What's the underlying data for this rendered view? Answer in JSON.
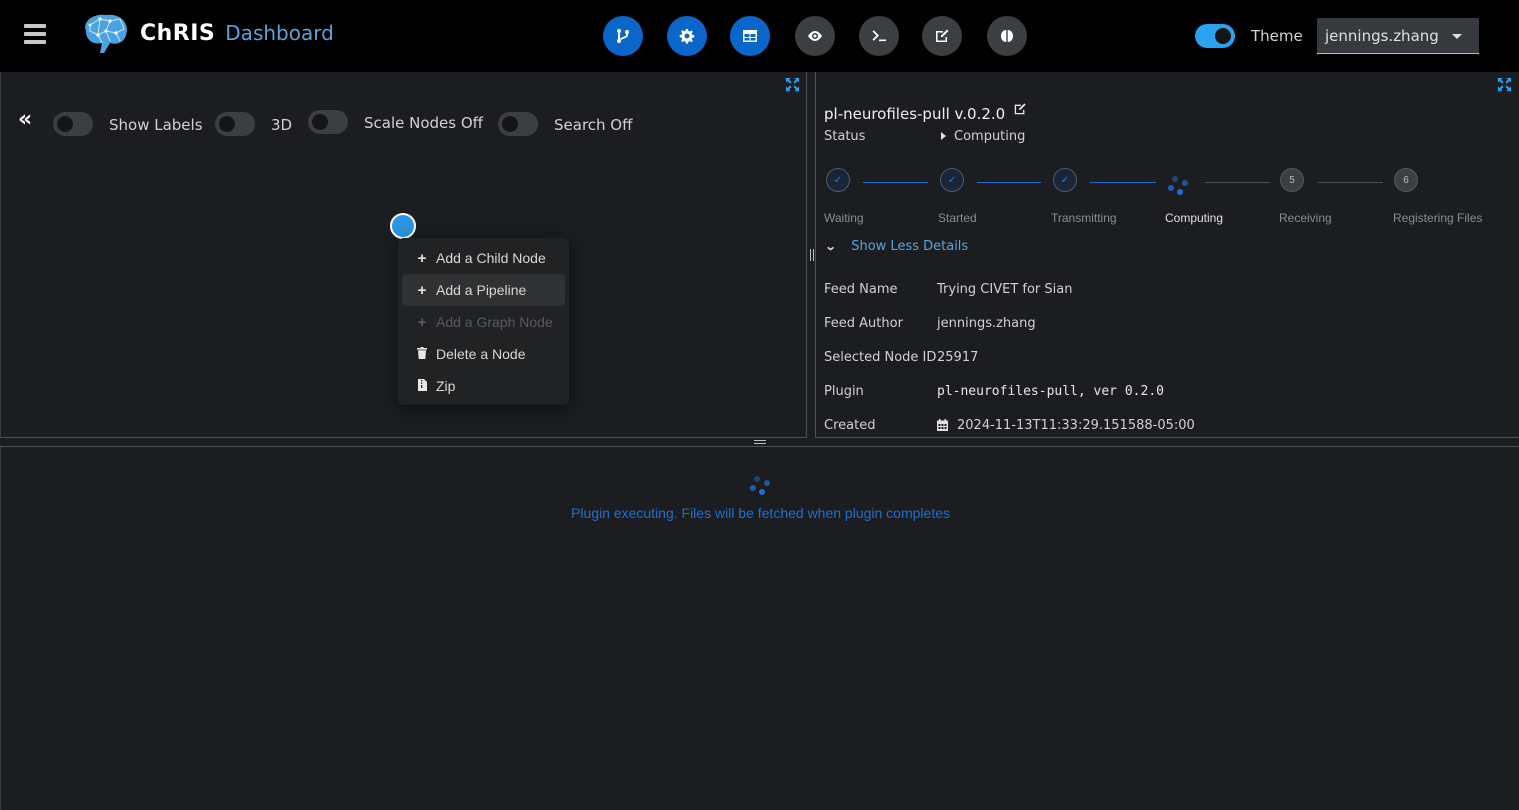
{
  "header": {
    "brand_name": "ChRIS",
    "brand_sub": "Dashboard",
    "menu_icon": "hamburger-icon",
    "tools": [
      {
        "name": "graph-tool-button",
        "icon": "code-branch-icon",
        "active": true
      },
      {
        "name": "node-settings-button",
        "icon": "gear-icon",
        "active": true
      },
      {
        "name": "table-view-button",
        "icon": "table-icon",
        "active": true
      },
      {
        "name": "preview-button",
        "icon": "eye-icon",
        "active": false
      },
      {
        "name": "terminal-button",
        "icon": "terminal-icon",
        "active": false
      },
      {
        "name": "notes-button",
        "icon": "edit-icon",
        "active": false
      },
      {
        "name": "brain-viewer-button",
        "icon": "brain-icon",
        "active": false
      }
    ],
    "theme_label": "Theme",
    "theme_on": true,
    "user": "jennings.zhang"
  },
  "graph": {
    "toggles": [
      {
        "label": "Show Labels",
        "on": false
      },
      {
        "label": "3D",
        "on": false
      },
      {
        "label": "Scale Nodes Off",
        "on": false
      },
      {
        "label": "Search Off",
        "on": false
      }
    ],
    "context_menu": [
      {
        "icon": "plus-icon",
        "label": "Add a Child Node",
        "disabled": false,
        "highlighted": false
      },
      {
        "icon": "plus-icon",
        "label": "Add a Pipeline",
        "disabled": false,
        "highlighted": true
      },
      {
        "icon": "plus-icon",
        "label": "Add a Graph Node",
        "disabled": true,
        "highlighted": false
      },
      {
        "icon": "trash-icon",
        "label": "Delete a Node",
        "disabled": false,
        "highlighted": false
      },
      {
        "icon": "file-zip-icon",
        "label": "Zip",
        "disabled": false,
        "highlighted": false
      }
    ]
  },
  "details": {
    "title": "pl-neurofiles-pull v.0.2.0",
    "status_label": "Status",
    "status_value": "Computing",
    "steps": [
      {
        "label": "Waiting",
        "state": "done"
      },
      {
        "label": "Started",
        "state": "done"
      },
      {
        "label": "Transmitting",
        "state": "done"
      },
      {
        "label": "Computing",
        "state": "current"
      },
      {
        "label": "Receiving",
        "state": "pending",
        "number": "5"
      },
      {
        "label": "Registering Files",
        "state": "pending",
        "number": "6"
      }
    ],
    "toggle_details": "Show Less Details",
    "rows": [
      {
        "key": "Feed Name",
        "value": "Trying CIVET for Sian"
      },
      {
        "key": "Feed Author",
        "value": "jennings.zhang"
      },
      {
        "key": "Selected Node ID",
        "value": "25917"
      },
      {
        "key": "Plugin",
        "value": "pl-neurofiles-pull, ver 0.2.0"
      },
      {
        "key": "Created",
        "value": "2024-11-13T11:33:29.151588-05:00"
      }
    ]
  },
  "files": {
    "message": "Plugin executing. Files will be fetched when plugin completes"
  }
}
